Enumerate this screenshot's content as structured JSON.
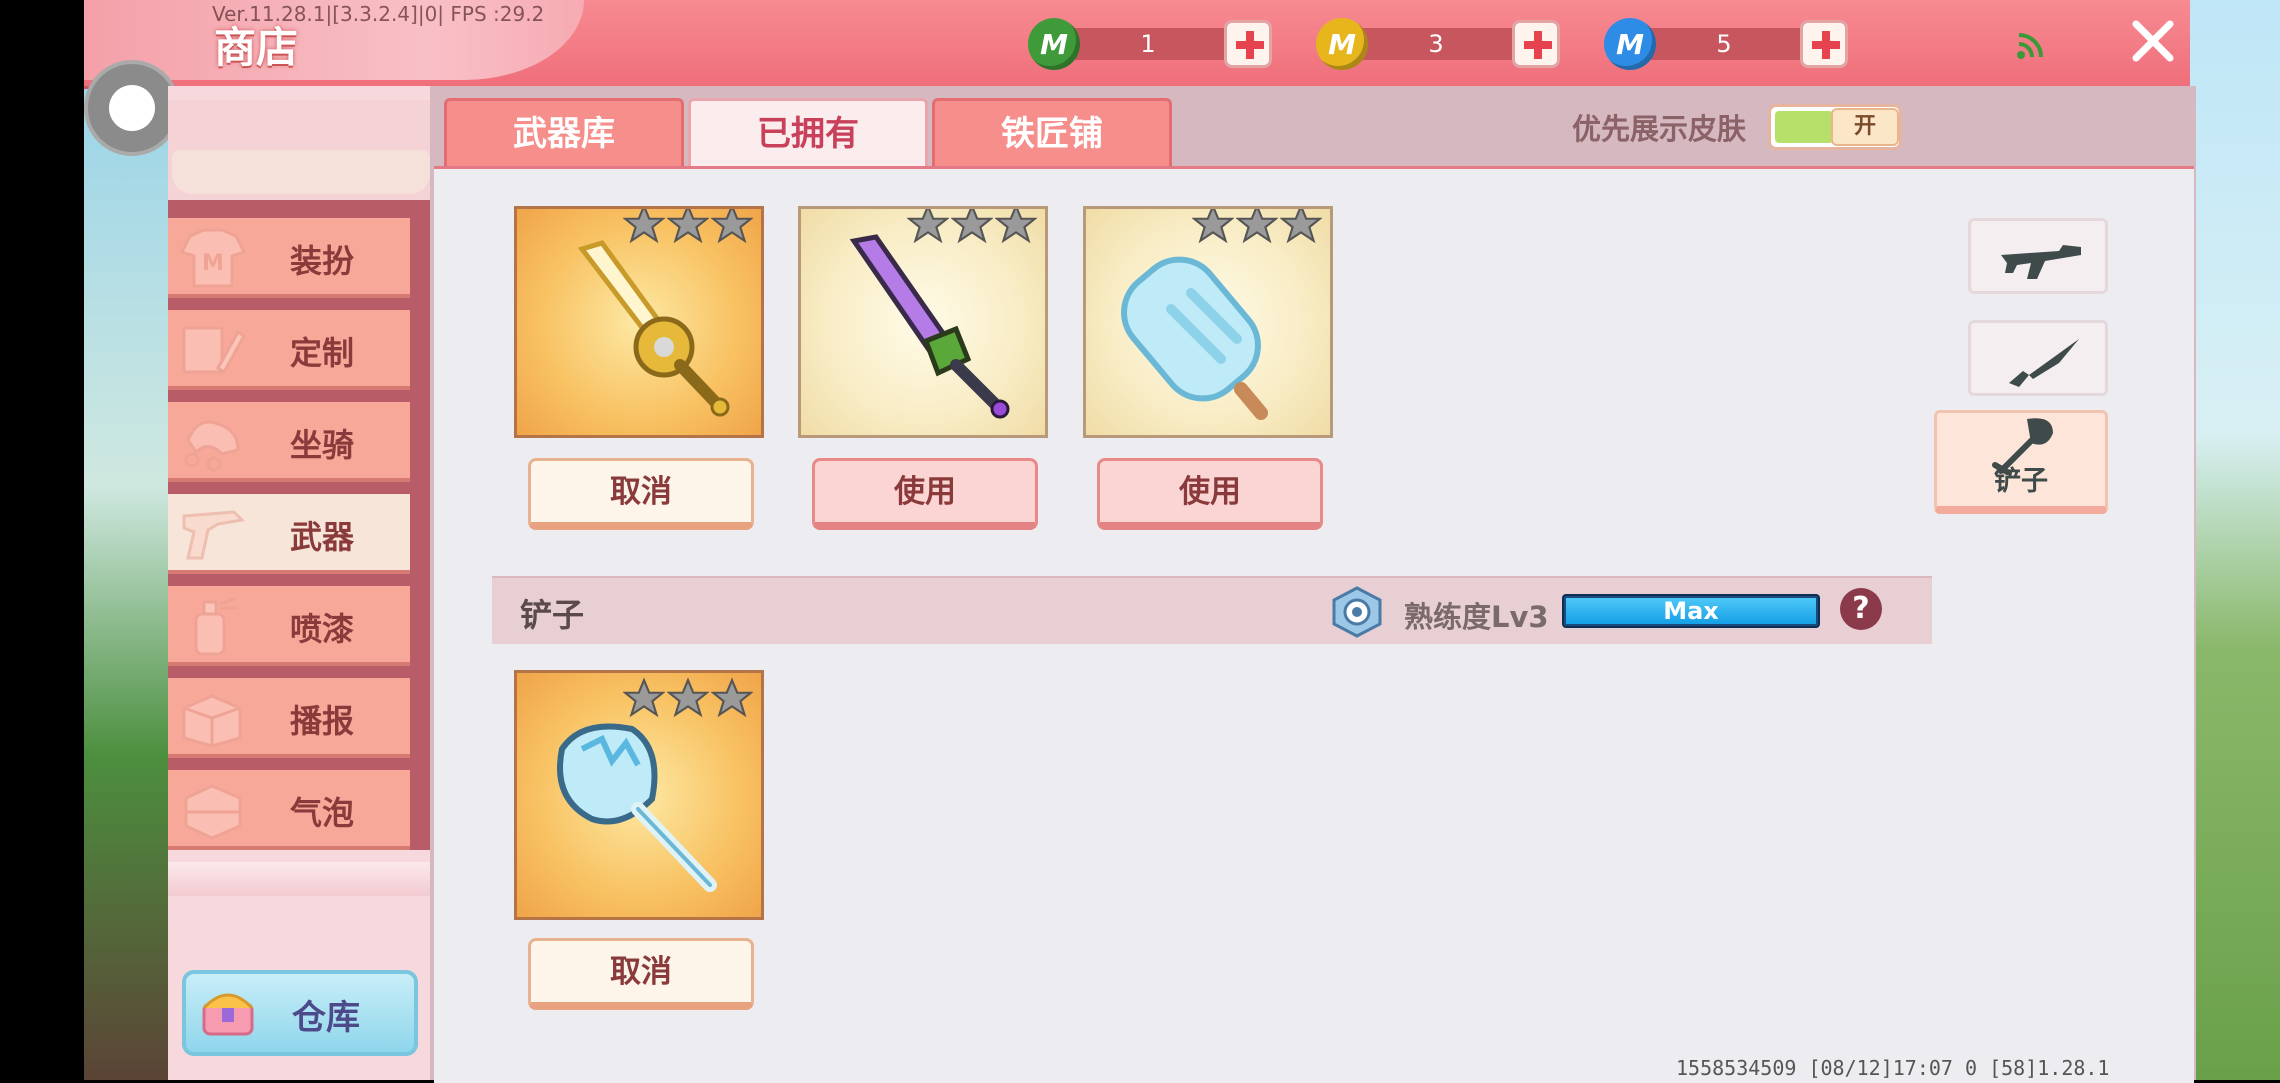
{
  "header": {
    "version": "Ver.11.28.1|[3.3.2.4]|0| FPS :29.2",
    "title": "商店",
    "currencies": [
      {
        "icon": "green-gem-coin-icon",
        "letter": "M",
        "amount": "1",
        "color": "#3f9a3a"
      },
      {
        "icon": "gold-coin-icon",
        "letter": "M",
        "amount": "3",
        "color": "#e7b51c"
      },
      {
        "icon": "blue-coin-icon",
        "letter": "M",
        "amount": "5",
        "color": "#2f8ce6"
      }
    ]
  },
  "sidebar": {
    "items": [
      {
        "label": "装扮",
        "icon": "tshirt-icon"
      },
      {
        "label": "定制",
        "icon": "pencil-icon"
      },
      {
        "label": "坐骑",
        "icon": "saddle-icon"
      },
      {
        "label": "武器",
        "icon": "gun-icon"
      },
      {
        "label": "喷漆",
        "icon": "spray-can-icon"
      },
      {
        "label": "播报",
        "icon": "box-icon"
      },
      {
        "label": "气泡",
        "icon": "bubble-icon"
      }
    ],
    "active_index": 3,
    "warehouse_label": "仓库"
  },
  "tabs": {
    "items": [
      "武器库",
      "已拥有",
      "铁匠铺"
    ],
    "active_index": 1
  },
  "skin_toggle": {
    "label": "优先展示皮肤",
    "state": "开"
  },
  "weapons_row": [
    {
      "name": "golden-sword",
      "action": "取消",
      "stars": 3
    },
    {
      "name": "purple-sword",
      "action": "使用",
      "stars": 3
    },
    {
      "name": "popsicle",
      "action": "使用",
      "stars": 3
    }
  ],
  "section": {
    "title": "铲子",
    "mastery_label": "熟练度Lv3",
    "mastery_value": "Max",
    "mastery_fraction": 1.0
  },
  "shovel_row": [
    {
      "name": "ice-shovel",
      "action": "取消",
      "stars": 3
    }
  ],
  "categories": [
    {
      "icon": "rifle-icon",
      "label": ""
    },
    {
      "icon": "knife-icon",
      "label": ""
    },
    {
      "icon": "shovel-icon",
      "label": "铲子"
    }
  ],
  "footer": {
    "info": "1558534509  [08/12]17:07 0  [58]1.28.1"
  },
  "colors": {
    "accent": "#ef6f7b",
    "active_tab_text": "#c9405a"
  }
}
